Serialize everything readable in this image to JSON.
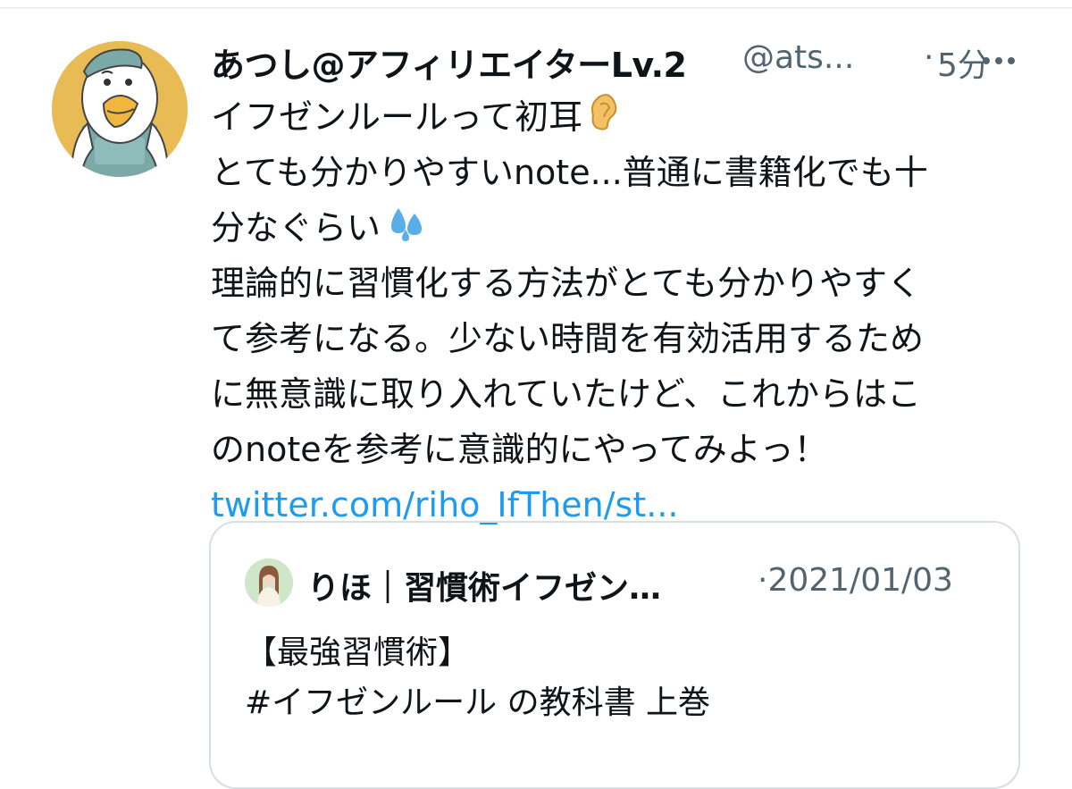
{
  "tweet": {
    "author_name": "あつし@アフィリエイターLv.2",
    "author_handle": "@ats...",
    "separator": "·",
    "time": "5分",
    "more_label": "···",
    "lines": [
      {
        "text": "イフゼンルールって初耳",
        "emoji": "ear-emoji"
      },
      {
        "text": "とても分かりやすいnote...普通に書籍化でも十"
      },
      {
        "text": "分なぐらい",
        "emoji": "sweat-droplets-emoji"
      },
      {
        "text": "理論的に習慣化する方法がとても分かりやすく"
      },
      {
        "text": "て参考になる。少ない時間を有効活用するため"
      },
      {
        "text": "に無意識に取り入れていたけど、これからはこ"
      },
      {
        "text": "のnoteを参考に意識的にやってみよっ！"
      }
    ],
    "link": "twitter.com/riho_IfThen/st..."
  },
  "quote": {
    "author_name": "りほ｜習慣術イフゼン…",
    "date": "·2021/01/03",
    "lines": [
      "【最強習慣術】",
      "#イフゼンルール の教科書 上巻"
    ]
  },
  "colors": {
    "text": "#0f1419",
    "muted": "#536471",
    "link": "#1d9bf0",
    "avatar_bg": "#e9bb55",
    "border": "#d9dee3"
  }
}
